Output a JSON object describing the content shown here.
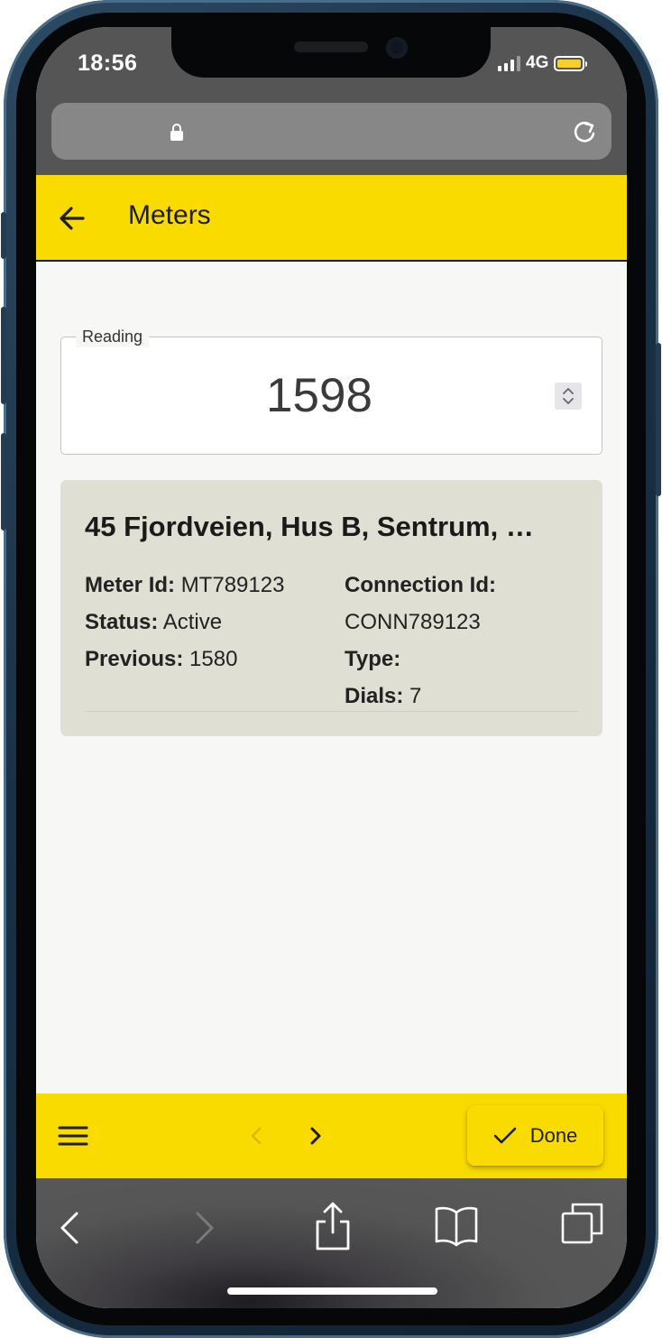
{
  "status_bar": {
    "time": "18:56",
    "network": "4G",
    "battery_color": "#f6cf2a"
  },
  "app_bar": {
    "title": "Meters",
    "color": "#fadb00"
  },
  "reading": {
    "label": "Reading",
    "value": "1598"
  },
  "meter_card": {
    "address": "45 Fjordveien, Hus B, Sentrum, …",
    "meter_id_label": "Meter Id:",
    "meter_id": "MT789123",
    "status_label": "Status:",
    "status": "Active",
    "previous_label": "Previous:",
    "previous": "1580",
    "connection_id_label": "Connection Id:",
    "connection_id": "CONN789123",
    "type_label": "Type:",
    "type": "",
    "dials_label": "Dials:",
    "dials": "7"
  },
  "bottom_bar": {
    "done_label": "Done"
  },
  "icons": {
    "back": "arrow-left-icon",
    "menu": "hamburger-menu-icon",
    "prev": "chevron-left-icon",
    "next": "chevron-right-icon",
    "done": "checkmark-icon",
    "lock": "lock-icon",
    "reload": "reload-icon",
    "browser_back": "browser-back-icon",
    "browser_forward": "browser-forward-icon",
    "share": "share-icon",
    "bookmarks": "bookmarks-icon",
    "tabs": "tabs-icon"
  }
}
